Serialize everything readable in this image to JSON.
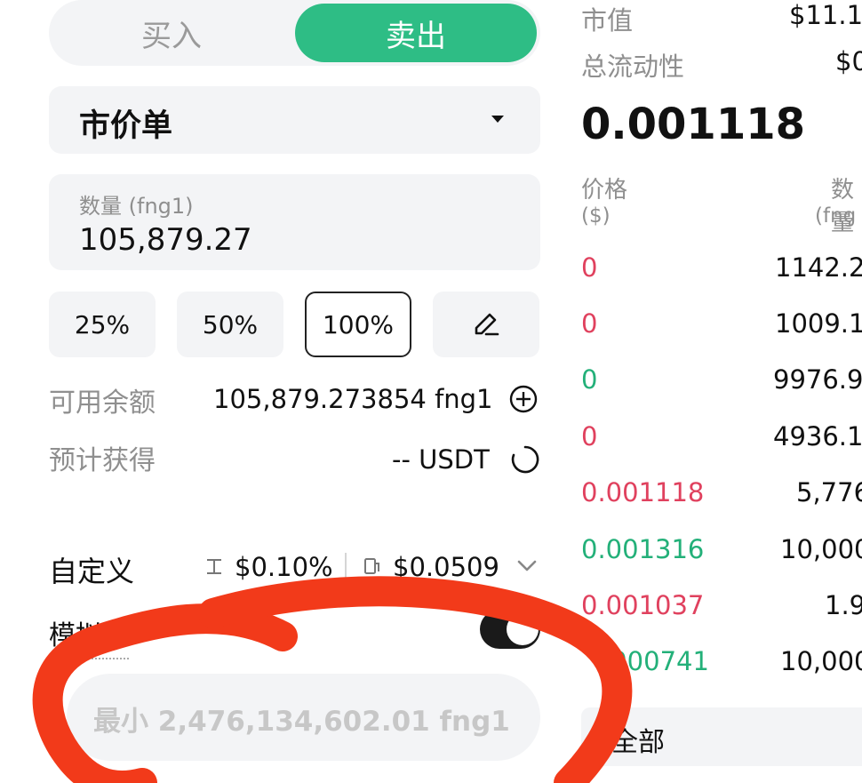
{
  "tabs": {
    "buy": "买入",
    "sell": "卖出"
  },
  "order_type": "市价单",
  "quantity": {
    "label": "数量 (fng1)",
    "value": "105,879.27"
  },
  "percent_buttons": [
    "25%",
    "50%",
    "100%"
  ],
  "available": {
    "label": "可用余额",
    "value": "105,879.273854 fng1"
  },
  "estimate": {
    "label": "预计获得",
    "value": "-- USDT"
  },
  "custom": {
    "label": "自定义",
    "slippage": "$0.10%",
    "gas": "$0.0509"
  },
  "simulate": {
    "label": "模拟检"
  },
  "min_input": {
    "placeholder": "最小 2,476,134,602.01 fng1"
  },
  "market": {
    "cap_label": "市值",
    "cap_value": "$11.1",
    "liquidity_label": "总流动性",
    "liquidity_value": "$0",
    "price": "0.001118"
  },
  "orderbook": {
    "price_header": "价格",
    "price_unit": "($)",
    "qty_header": "数量",
    "qty_unit": "(fng",
    "rows": [
      {
        "price": "0",
        "qty": "1142.2",
        "side": "red"
      },
      {
        "price": "0",
        "qty": "1009.1",
        "side": "red"
      },
      {
        "price": "0",
        "qty": "9976.9",
        "side": "green"
      },
      {
        "price": "0",
        "qty": "4936.1",
        "side": "red"
      },
      {
        "price": "0.001118",
        "qty": "5,776",
        "side": "red"
      },
      {
        "price": "0.001316",
        "qty": "10,000",
        "side": "green"
      },
      {
        "price": "0.001037",
        "qty": "1.9",
        "side": "red"
      },
      {
        "price": ".000741",
        "qty": "10,000",
        "side": "green"
      }
    ]
  },
  "filter": {
    "label": "全部"
  },
  "colors": {
    "accent": "#2ebd85",
    "red": "#e0415e",
    "green": "#23b079",
    "annotation": "#f23a1a"
  }
}
